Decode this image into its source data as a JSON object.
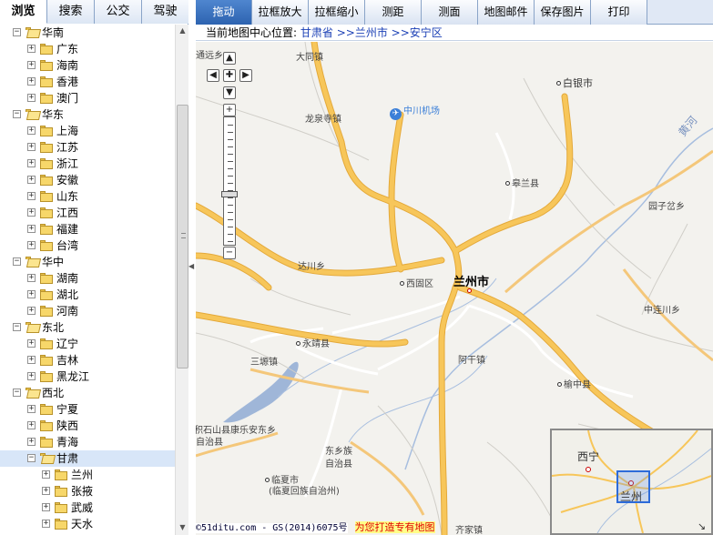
{
  "left_tabs": [
    "浏览",
    "搜索",
    "公交",
    "驾驶"
  ],
  "tree": [
    {
      "label": "华南",
      "level": 0,
      "open": true
    },
    {
      "label": "广东",
      "level": 1
    },
    {
      "label": "海南",
      "level": 1
    },
    {
      "label": "香港",
      "level": 1
    },
    {
      "label": "澳门",
      "level": 1
    },
    {
      "label": "华东",
      "level": 0,
      "open": true
    },
    {
      "label": "上海",
      "level": 1
    },
    {
      "label": "江苏",
      "level": 1
    },
    {
      "label": "浙江",
      "level": 1
    },
    {
      "label": "安徽",
      "level": 1
    },
    {
      "label": "山东",
      "level": 1
    },
    {
      "label": "江西",
      "level": 1
    },
    {
      "label": "福建",
      "level": 1
    },
    {
      "label": "台湾",
      "level": 1
    },
    {
      "label": "华中",
      "level": 0,
      "open": true
    },
    {
      "label": "湖南",
      "level": 1
    },
    {
      "label": "湖北",
      "level": 1
    },
    {
      "label": "河南",
      "level": 1
    },
    {
      "label": "东北",
      "level": 0,
      "open": true
    },
    {
      "label": "辽宁",
      "level": 1
    },
    {
      "label": "吉林",
      "level": 1
    },
    {
      "label": "黑龙江",
      "level": 1
    },
    {
      "label": "西北",
      "level": 0,
      "open": true
    },
    {
      "label": "宁夏",
      "level": 1
    },
    {
      "label": "陕西",
      "level": 1
    },
    {
      "label": "青海",
      "level": 1
    },
    {
      "label": "甘肃",
      "level": 1,
      "open": true,
      "selected": true
    },
    {
      "label": "兰州",
      "level": 2
    },
    {
      "label": "张掖",
      "level": 2
    },
    {
      "label": "武威",
      "level": 2
    },
    {
      "label": "天水",
      "level": 2
    }
  ],
  "toolbar": [
    "拖动",
    "拉框放大",
    "拉框缩小",
    "测距",
    "测面",
    "地图邮件",
    "保存图片",
    "打印"
  ],
  "location": {
    "prefix": "当前地图中心位置:",
    "province": "甘肃省",
    "sep": ">>",
    "city": "兰州市",
    "district": "安宁区"
  },
  "map": {
    "places": [
      {
        "name": "通远乡"
      },
      {
        "name": "大同镇"
      },
      {
        "name": "龙泉寺镇"
      },
      {
        "name": "中川机场"
      },
      {
        "name": "白银市"
      },
      {
        "name": "皋兰县"
      },
      {
        "name": "园子岔乡"
      },
      {
        "name": "达川乡"
      },
      {
        "name": "西固区"
      },
      {
        "name": "兰州市"
      },
      {
        "name": "中连川乡"
      },
      {
        "name": "永靖县"
      },
      {
        "name": "三塬镇"
      },
      {
        "name": "阿干镇"
      },
      {
        "name": "榆中县"
      },
      {
        "name": "积石山县康乐安东乡"
      },
      {
        "name": "自治县"
      },
      {
        "name": "东乡族"
      },
      {
        "name": "自治县"
      },
      {
        "name": "临夏市"
      },
      {
        "name": "(临夏回族自治州)"
      },
      {
        "name": "齐家镇"
      },
      {
        "name": "黄河"
      }
    ],
    "overview": {
      "labels": [
        "西宁",
        "兰州"
      ]
    }
  },
  "footer": {
    "code": "©51ditu.com - GS(2014)6075号",
    "ad": "为您打造专有地图"
  },
  "colors": {
    "road": "#f7c65a",
    "road_edge": "#e4a93a",
    "water": "#9fb6d8",
    "active_tab": "#3a70bd"
  }
}
